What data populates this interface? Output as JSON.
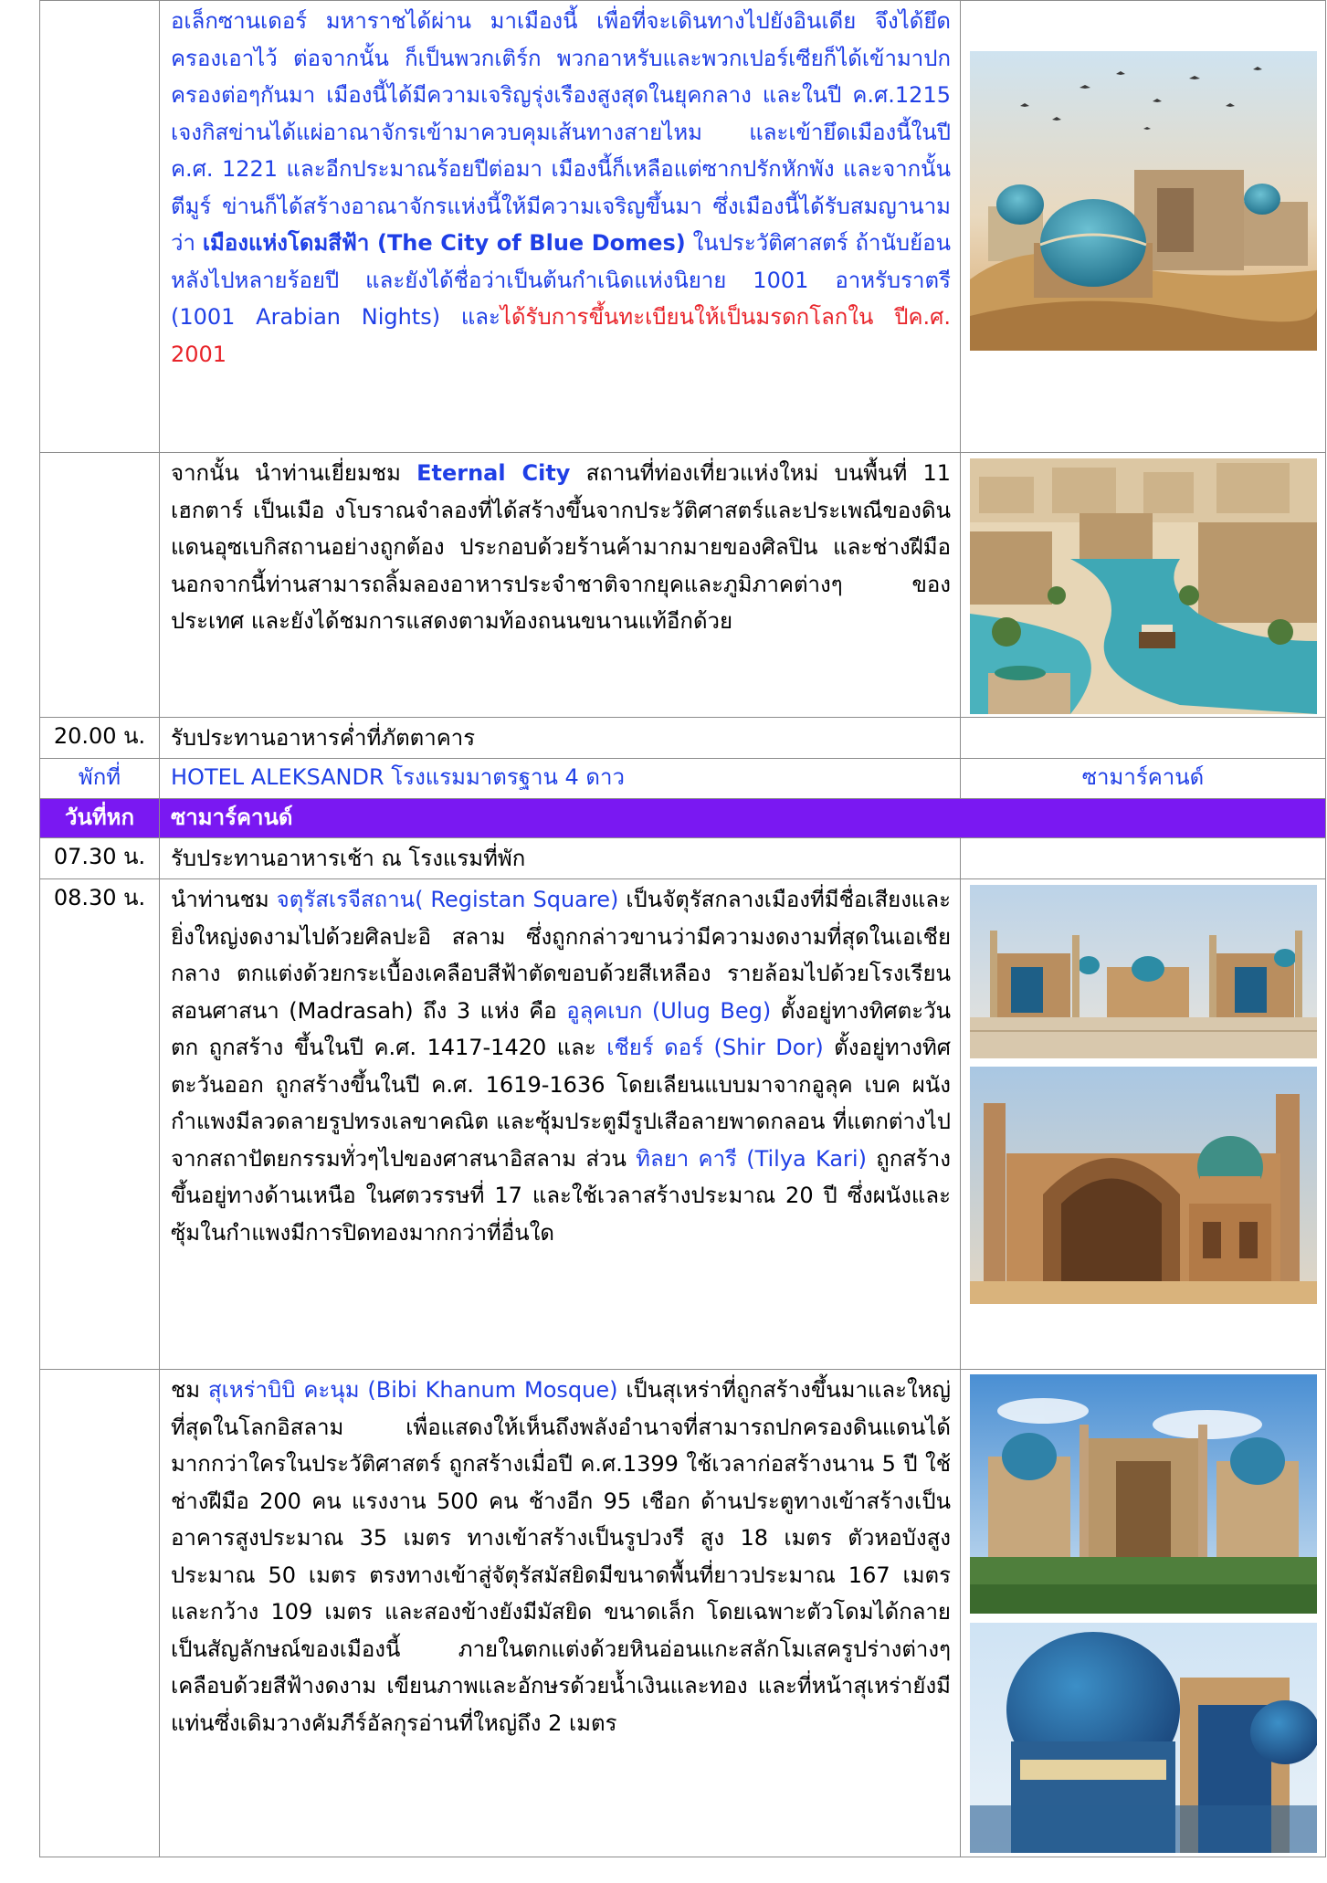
{
  "row_samarkand_history": {
    "time": "",
    "segments": [
      {
        "t": "อเล็กซานเดอร์ มหาราชได้ผ่าน มาเมืองนี้ เพื่อที่จะเดินทางไปยังอินเดีย จึงได้ยึดครองเอาไว้ ต่อจากนั้น ก็เป็นพวกเติร์ก พวกอาหรับและพวกเปอร์เซียก็ได้เข้ามาปกครองต่อๆกันมา เมืองนี้ได้มีความเจริญรุ่งเรืองสูงสุดในยุคกลาง และในปี ค.ศ.1215 เจงกิสข่านได้แผ่อาณาจักรเข้ามาควบคุมเส้นทางสายไหม และเข้ายึดเมืองนี้ในปี ค.ศ. 1221 และอีกประมาณร้อยปีต่อมา เมืองนี้ก็เหลือแต่ซากปรักหักพัง และจากนั้นตีมูร์ ข่านก็ได้สร้างอาณาจักรแห่งนี้ให้มีความเจริญขึ้นมา ซึ่งเมืองนี้ได้รับสมญานามว่า ",
        "c": "blue"
      },
      {
        "t": "เมืองแห่งโดมสีฟ้า (The City of Blue Domes)",
        "c": "blue b"
      },
      {
        "t": " ในประวัติศาสตร์ ถ้านับย้อนหลังไปหลายร้อยปี และยังได้ชื่อว่าเป็นต้นกำเนิดแห่งนิยาย 1001 อาหรับราตรี (1001 Arabian Nights) และ",
        "c": "blue"
      },
      {
        "t": "ได้รับการขึ้นทะเบียนให้เป็นมรดกโลกใน ปีค.ศ. 2001",
        "c": "red"
      }
    ],
    "image": "samarkand-blue-domes-photo"
  },
  "row_eternal_city": {
    "time": "",
    "segments": [
      {
        "t": "จากนั้น นำท่านเยี่ยมชม ",
        "c": ""
      },
      {
        "t": "Eternal City",
        "c": "blue b"
      },
      {
        "t": " สถานที่ท่องเที่ยวแห่งใหม่ บนพื้นที่ 11 เฮกตาร์ เป็นเมือ งโบราณจำลองที่ได้สร้างขึ้นจากประวัติศาสตร์และประเพณีของดินแดนอุซเบกิสถานอย่างถูกต้อง ประกอบด้วยร้านค้ามากมายของศิลปิน และช่างฝีมือ นอกจากนี้ท่านสามารถลิ้มลองอาหารประจำชาติจากยุคและภูมิภาคต่างๆ ของประเทศ และยังได้ชมการแสดงตามท้องถนนขนานแท้อีกด้วย",
        "c": ""
      }
    ],
    "image": "eternal-city-canal-photo"
  },
  "row_dinner": {
    "time": "20.00 น.",
    "text": "รับประทานอาหารค่ำที่ภัตตาคาร"
  },
  "row_stay": {
    "label": "พักที่",
    "hotel": "HOTEL ALEKSANDR โรงแรมมาตรฐาน 4 ดาว",
    "city": "ซามาร์คานด์"
  },
  "day_header": {
    "day": "วันที่หก",
    "title": "ซามาร์คานด์"
  },
  "row_breakfast": {
    "time": "07.30 น.",
    "text": "รับประทานอาหารเช้า ณ โรงแรมที่พัก"
  },
  "row_registan": {
    "time": "08.30 น.",
    "segments": [
      {
        "t": "นำท่านชม ",
        "c": ""
      },
      {
        "t": "จตุรัสเรจีสถาน( Registan Square)",
        "c": "blue"
      },
      {
        "t": " เป็นจัตุรัสกลางเมืองที่มีชื่อเสียงและยิ่งใหญ่งดงามไปด้วยศิลปะอิ สลาม ซึ่งถูกกล่าวขานว่ามีความงดงามที่สุดในเอเชียกลาง ตกแต่งด้วยกระเบื้องเคลือบสีฟ้าตัดขอบด้วยสีเหลือง รายล้อมไปด้วยโรงเรียนสอนศาสนา (Madrasah) ถึง 3 แห่ง คือ ",
        "c": ""
      },
      {
        "t": "อูลุคเบก (Ulug Beg)",
        "c": "blue"
      },
      {
        "t": " ตั้งอยู่ทางทิศตะวันตก ถูกสร้าง ขึ้นในปี ค.ศ. 1417-1420 และ ",
        "c": ""
      },
      {
        "t": "เชียร์ ดอร์ (Shir Dor)",
        "c": "blue"
      },
      {
        "t": " ตั้งอยู่ทางทิศตะวันออก ถูกสร้างขึ้นในปี ค.ศ. 1619-1636 โดยเลียนแบบมาจากอูลุค เบค ผนังกำแพงมีลวดลายรูปทรงเลขาคณิต และซุ้มประตูมีรูปเสือลายพาดกลอน ที่แตกต่างไปจากสถาปัตยกรรมทั่วๆไปของศาสนาอิสลาม ส่วน ",
        "c": ""
      },
      {
        "t": "ทิลยา คารี (Tilya Kari)",
        "c": "blue"
      },
      {
        "t": " ถูกสร้างขึ้นอยู่ทางด้านเหนือ ในศตวรรษที่ 17 และใช้เวลาสร้างประมาณ 20 ปี ซึ่งผนังและซุ้มในกำแพงมีการปิดทองมากกว่าที่อื่นใด",
        "c": ""
      }
    ],
    "images": [
      "registan-square-wide-photo",
      "shir-dor-madrasah-photo"
    ]
  },
  "row_bibi_khanum": {
    "time": "",
    "segments": [
      {
        "t": "ชม ",
        "c": ""
      },
      {
        "t": "สุเหร่าบิบิ คะนุม (Bibi Khanum Mosque)",
        "c": "blue"
      },
      {
        "t": " เป็นสุเหร่าที่ถูกสร้างขึ้นมาและใหญ่ที่สุดในโลกอิสลาม เพื่อแสดงให้เห็นถึงพลังอำนาจที่สามารถปกครองดินแดนได้มากกว่าใครในประวัติศาสตร์ ถูกสร้างเมื่อปี ค.ศ.1399 ใช้เวลาก่อสร้างนาน 5 ปี ใช้ช่างฝีมือ 200 คน แรงงาน 500 คน ช้างอีก 95 เชือก ด้านประตูทางเข้าสร้างเป็นอาคารสูงประมาณ 35 เมตร ทางเข้าสร้างเป็นรูปวงรี สูง 18 เมตร ตัวหอบังสูงประมาณ 50 เมตร ตรงทางเข้าสู่จัตุรัสมัสยิดมีขนาดพื้นที่ยาวประมาณ 167 เมตร และกว้าง 109 เมตร และสองข้างยังมีมัสยิด ขนาดเล็ก โดยเฉพาะตัวโดมได้กลายเป็นสัญลักษณ์ของเมืองนี้ ภายในตกแต่งด้วยหินอ่อนแกะสลักโมเสครูปร่างต่างๆ เคลือบด้วยสีฟ้างดงาม เขียนภาพและอักษรด้วยน้ำเงินและทอง และที่หน้าสุเหร่ายังมีแท่นซึ่งเดิมวางคัมภีร์อัลกุรอ่านที่ใหญ่ถึง 2 เมตร",
        "c": ""
      }
    ],
    "images": [
      "bibi-khanum-mosque-wide-photo",
      "bibi-khanum-dome-photo"
    ]
  },
  "colors": {
    "day_header_bg": "#7a18f2",
    "link_blue": "#1f3fe6",
    "heritage_red": "#e8242a",
    "border": "#8c8c8c"
  }
}
